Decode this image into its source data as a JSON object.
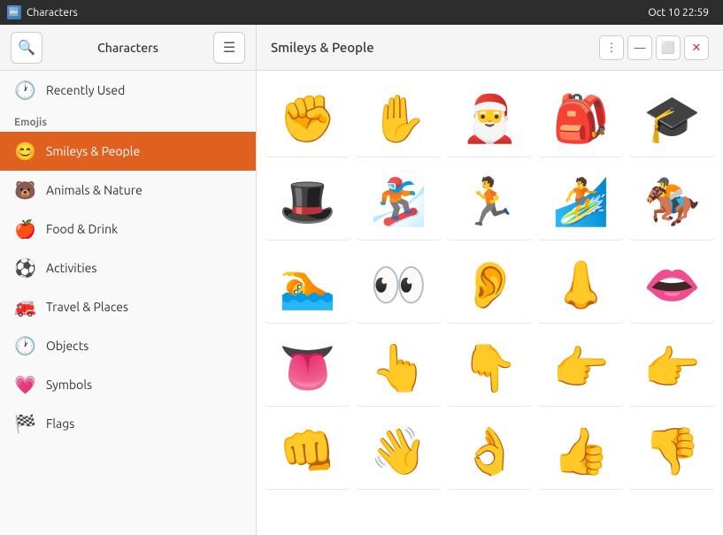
{
  "titlebar": {
    "icon": "🔤",
    "title": "Characters",
    "clock": "Oct 10  22:59"
  },
  "left_header": {
    "search_label": "🔍",
    "title": "Characters",
    "menu_label": "☰"
  },
  "right_header": {
    "title": "Smileys & People",
    "more_label": "⋮",
    "minimize_label": "—",
    "maximize_label": "⬜",
    "close_label": "✕"
  },
  "sidebar": {
    "recently_used_label": "Recently Used",
    "recently_used_icon": "🕐",
    "section_emojis": "Emojis",
    "items": [
      {
        "id": "smileys",
        "label": "Smileys & People",
        "icon": "😊",
        "active": true
      },
      {
        "id": "animals",
        "label": "Animals & Nature",
        "icon": "🐻",
        "active": false
      },
      {
        "id": "food",
        "label": "Food & Drink",
        "icon": "🍎",
        "active": false
      },
      {
        "id": "activities",
        "label": "Activities",
        "icon": "⚽",
        "active": false
      },
      {
        "id": "travel",
        "label": "Travel & Places",
        "icon": "🚒",
        "active": false
      },
      {
        "id": "objects",
        "label": "Objects",
        "icon": "🕐",
        "active": false
      },
      {
        "id": "symbols",
        "label": "Symbols",
        "icon": "💗",
        "active": false
      },
      {
        "id": "flags",
        "label": "Flags",
        "icon": "🏁",
        "active": false
      }
    ]
  },
  "emojis": [
    "✊",
    "✋",
    "🎅",
    "🎒",
    "🎓",
    "🎩",
    "🏂",
    "🏃",
    "🏄",
    "🏇",
    "🏊",
    "👀",
    "👂",
    "👃",
    "👄",
    "👅",
    "👆",
    "👇",
    "👉",
    "👉",
    "👊",
    "👋",
    "👌",
    "👍",
    "👎"
  ]
}
